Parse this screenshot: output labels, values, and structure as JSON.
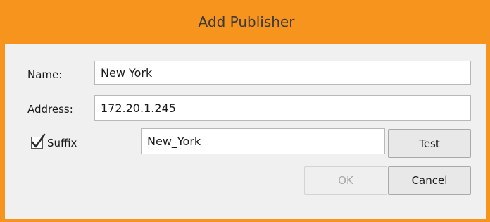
{
  "dialog": {
    "title": "Add Publisher",
    "accent_color": "#f7941d"
  },
  "form": {
    "name": {
      "label": "Name:",
      "value": "New York"
    },
    "address": {
      "label": "Address:",
      "value": "172.20.1.245"
    },
    "suffix": {
      "label": "Suffix",
      "checked": true,
      "value": "New_York"
    }
  },
  "buttons": {
    "test": "Test",
    "ok": "OK",
    "cancel": "Cancel"
  },
  "icons": {
    "checkbox_check": "checkmark-icon"
  }
}
